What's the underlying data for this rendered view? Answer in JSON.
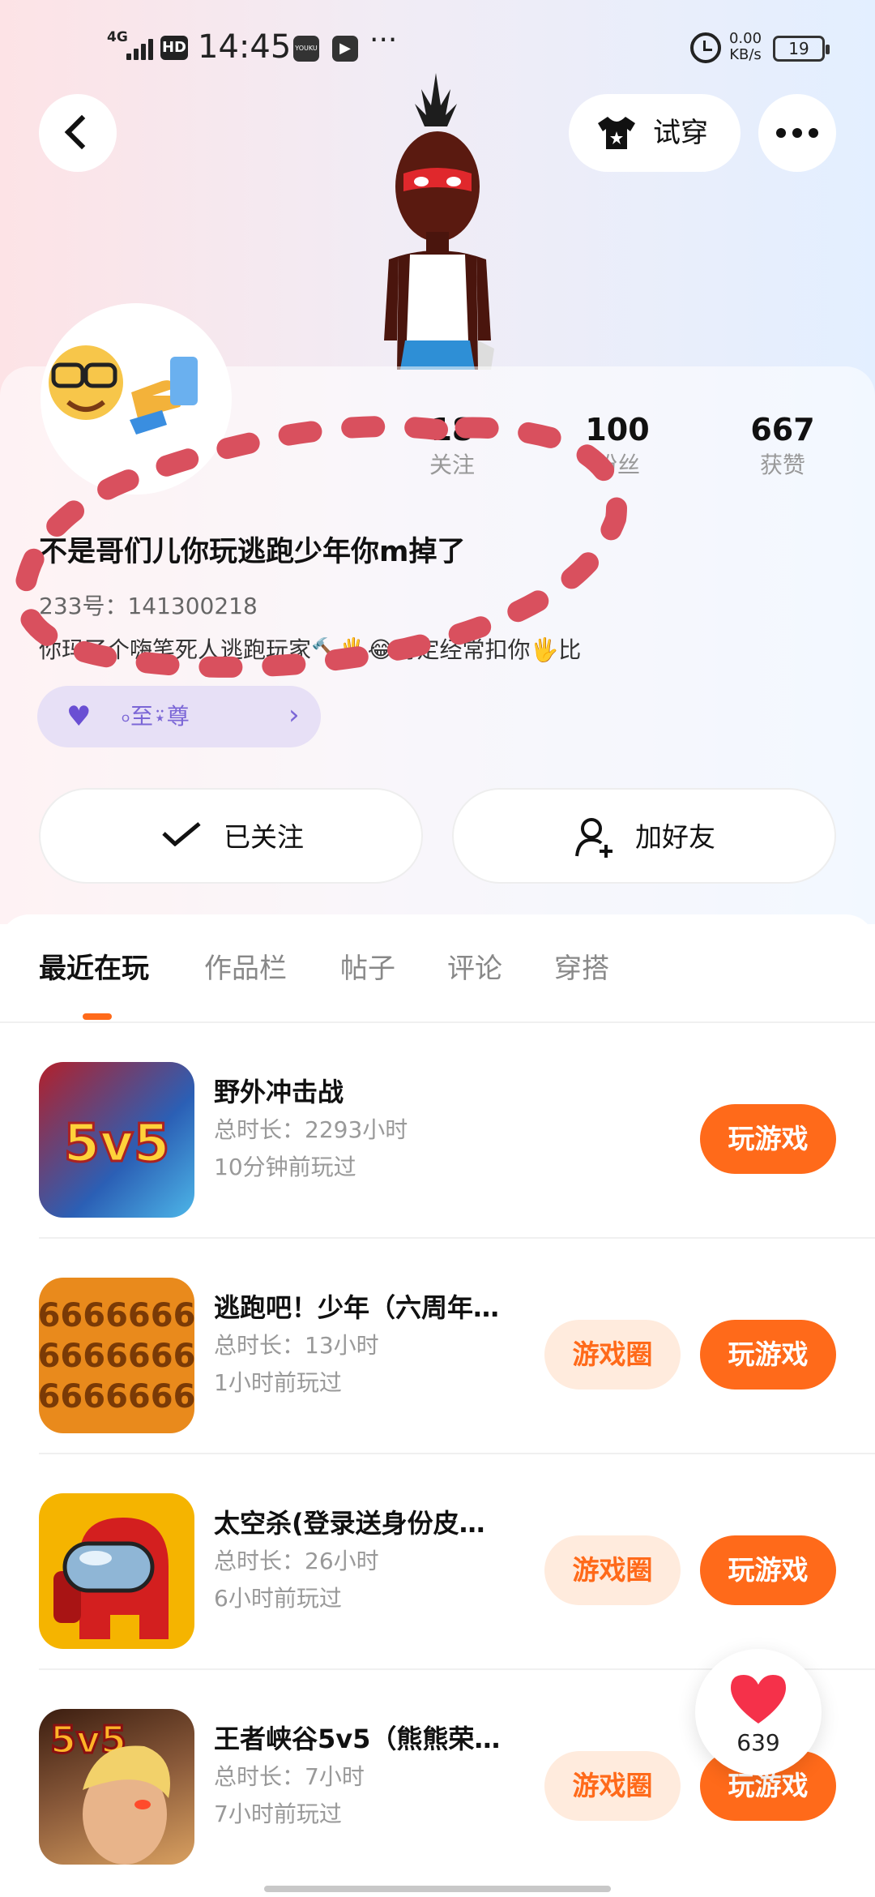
{
  "status_bar": {
    "network": "4G",
    "hd": "HD",
    "time": "14:45",
    "app_icon_1": "YOUKU",
    "more": "···",
    "net_speed": "0.00",
    "net_speed_unit": "KB/s",
    "battery": "19"
  },
  "header": {
    "back_icon": "chevron-left-icon",
    "try_on_label": "试穿",
    "try_on_icon": "tshirt-icon",
    "more_icon": "more-dots-icon"
  },
  "profile": {
    "stats": [
      {
        "value": "18",
        "label": "关注"
      },
      {
        "value": "100",
        "label": "粉丝"
      },
      {
        "value": "667",
        "label": "获赞"
      }
    ],
    "nickname": "不是哥们儿你玩逃跑少年你m掉了",
    "uid": "233号：141300218",
    "bio": "你玛了个嗨笔死人逃跑玩家🔨🖐😂肯定经常扣你🖐比",
    "badge": {
      "icon": "♥",
      "text": "৹至⍣尊",
      "arrow": "›"
    }
  },
  "actions": {
    "follow_label": "已关注",
    "add_friend_label": "加好友"
  },
  "tabs": [
    "最近在玩",
    "作品栏",
    "帖子",
    "评论",
    "穿搭"
  ],
  "games": [
    {
      "name": "野外冲击战",
      "duration": "总时长：2293小时",
      "last_played": "10分钟前玩过",
      "circle_label": "",
      "play_label": "玩游戏",
      "icon_text": "5v5"
    },
    {
      "name": "逃跑吧！少年（六周年…",
      "duration": "总时长：13小时",
      "last_played": "1小时前玩过",
      "circle_label": "游戏圈",
      "play_label": "玩游戏",
      "icon_text": "6666666"
    },
    {
      "name": "太空杀(登录送身份皮…",
      "duration": "总时长：26小时",
      "last_played": "6小时前玩过",
      "circle_label": "游戏圈",
      "play_label": "玩游戏",
      "icon_text": ""
    },
    {
      "name": "王者峡谷5v5（熊熊荣…",
      "duration": "总时长：7小时",
      "last_played": "7小时前玩过",
      "circle_label": "游戏圈",
      "play_label": "玩游戏",
      "icon_text": "5v5"
    }
  ],
  "like_float": {
    "count": "639"
  },
  "colors": {
    "accent": "#ff6a1a",
    "accent_light": "#ffebdd",
    "badge_bg": "#e7e0f6",
    "scribble": "#d9505e"
  }
}
